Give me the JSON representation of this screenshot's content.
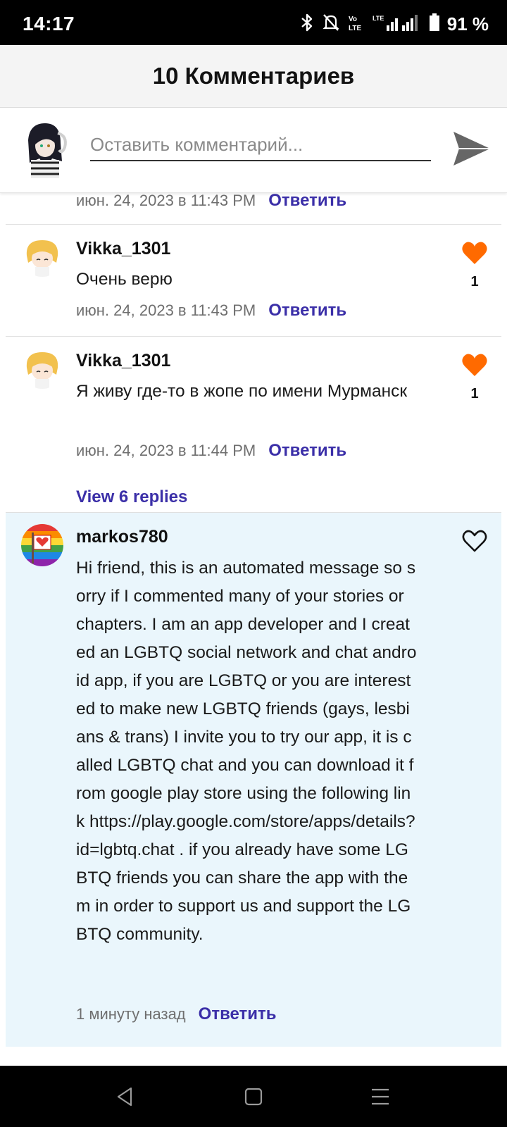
{
  "status_bar": {
    "time": "14:17",
    "battery": "91 %",
    "icons": [
      "bluetooth-icon",
      "bell-off-icon",
      "volte-icon",
      "lte-signal-icon",
      "battery-icon"
    ]
  },
  "header": {
    "title": "10 Комментариев"
  },
  "composer": {
    "placeholder": "Оставить комментарий...",
    "send_icon": "send-icon"
  },
  "partial_comment": {
    "timestamp": "июн. 24, 2023 в 11:43 PM",
    "reply_label": "Ответить"
  },
  "comments": [
    {
      "username": "Vikka_1301",
      "text": "Очень верю",
      "timestamp": "июн. 24, 2023 в 11:43 PM",
      "reply_label": "Ответить",
      "likes": "1",
      "liked": true
    },
    {
      "username": "Vikka_1301",
      "text": "Я живу где-то в жопе по имени Мурманск",
      "timestamp": "июн. 24, 2023 в 11:44 PM",
      "reply_label": "Ответить",
      "likes": "1",
      "liked": true,
      "view_replies": "View 6 replies"
    },
    {
      "username": "markos780",
      "text": "Hi friend, this is an automated message so sorry if I commented many of your stories or chapters. I am an app developer and I created an LGBTQ social network and chat android app, if you are LGBTQ or you are interested to make new LGBTQ friends (gays, lesbians & trans) I invite you to try our app, it is called LGBTQ chat and you can download it from google play store using the following link https://play.google.com/store/apps/details?id=lgbtq.chat . if you already have some LGBTQ friends you can share the app with them in order to support us and support the LGBTQ community.",
      "timestamp": "1 минуту назад",
      "reply_label": "Ответить",
      "liked": false
    }
  ],
  "colors": {
    "accent": "#3b2fa8",
    "heart": "#ff6a00",
    "highlight_bg": "#eaf6fc"
  },
  "navbar": {
    "icons": [
      "back-icon",
      "home-icon",
      "menu-icon"
    ]
  }
}
